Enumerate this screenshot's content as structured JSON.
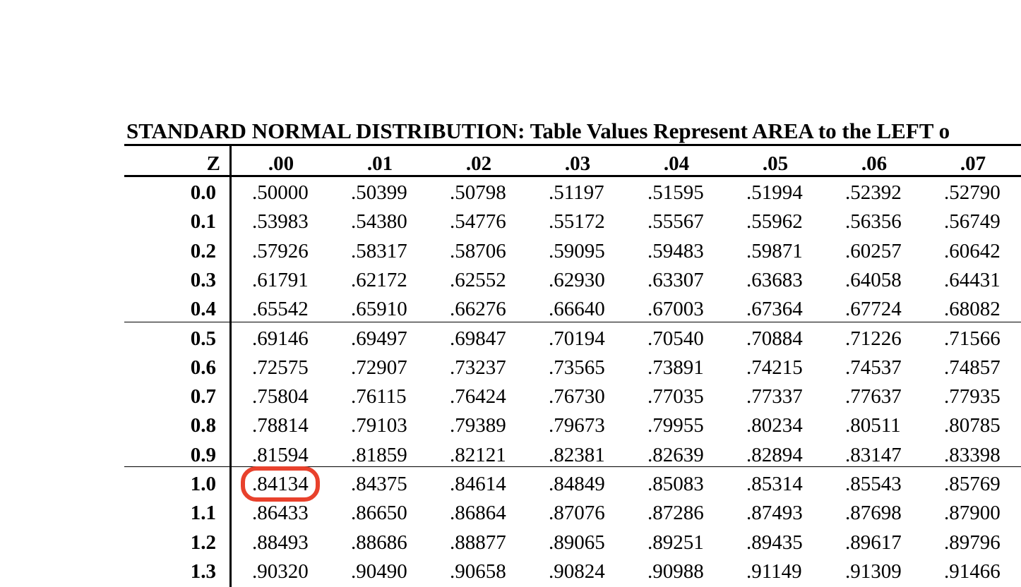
{
  "table": {
    "title": "STANDARD NORMAL DISTRIBUTION: Table Values Represent AREA to the LEFT o",
    "z_header": "Z",
    "columns": [
      ".00",
      ".01",
      ".02",
      ".03",
      ".04",
      ".05",
      ".06",
      ".07"
    ],
    "rows": [
      {
        "z": "0.0",
        "values": [
          ".50000",
          ".50399",
          ".50798",
          ".51197",
          ".51595",
          ".51994",
          ".52392",
          ".52790"
        ]
      },
      {
        "z": "0.1",
        "values": [
          ".53983",
          ".54380",
          ".54776",
          ".55172",
          ".55567",
          ".55962",
          ".56356",
          ".56749"
        ]
      },
      {
        "z": "0.2",
        "values": [
          ".57926",
          ".58317",
          ".58706",
          ".59095",
          ".59483",
          ".59871",
          ".60257",
          ".60642"
        ]
      },
      {
        "z": "0.3",
        "values": [
          ".61791",
          ".62172",
          ".62552",
          ".62930",
          ".63307",
          ".63683",
          ".64058",
          ".64431"
        ]
      },
      {
        "z": "0.4",
        "values": [
          ".65542",
          ".65910",
          ".66276",
          ".66640",
          ".67003",
          ".67364",
          ".67724",
          ".68082"
        ]
      },
      {
        "z": "0.5",
        "values": [
          ".69146",
          ".69497",
          ".69847",
          ".70194",
          ".70540",
          ".70884",
          ".71226",
          ".71566"
        ]
      },
      {
        "z": "0.6",
        "values": [
          ".72575",
          ".72907",
          ".73237",
          ".73565",
          ".73891",
          ".74215",
          ".74537",
          ".74857"
        ]
      },
      {
        "z": "0.7",
        "values": [
          ".75804",
          ".76115",
          ".76424",
          ".76730",
          ".77035",
          ".77337",
          ".77637",
          ".77935"
        ]
      },
      {
        "z": "0.8",
        "values": [
          ".78814",
          ".79103",
          ".79389",
          ".79673",
          ".79955",
          ".80234",
          ".80511",
          ".80785"
        ]
      },
      {
        "z": "0.9",
        "values": [
          ".81594",
          ".81859",
          ".82121",
          ".82381",
          ".82639",
          ".82894",
          ".83147",
          ".83398"
        ]
      },
      {
        "z": "1.0",
        "values": [
          ".84134",
          ".84375",
          ".84614",
          ".84849",
          ".85083",
          ".85314",
          ".85543",
          ".85769"
        ]
      },
      {
        "z": "1.1",
        "values": [
          ".86433",
          ".86650",
          ".86864",
          ".87076",
          ".87286",
          ".87493",
          ".87698",
          ".87900"
        ]
      },
      {
        "z": "1.2",
        "values": [
          ".88493",
          ".88686",
          ".88877",
          ".89065",
          ".89251",
          ".89435",
          ".89617",
          ".89796"
        ]
      },
      {
        "z": "1.3",
        "values": [
          ".90320",
          ".90490",
          ".90658",
          ".90824",
          ".90988",
          ".91149",
          ".91309",
          ".91466"
        ]
      }
    ],
    "highlight": {
      "row": 10,
      "col": 0,
      "color": "#e8412c"
    }
  }
}
